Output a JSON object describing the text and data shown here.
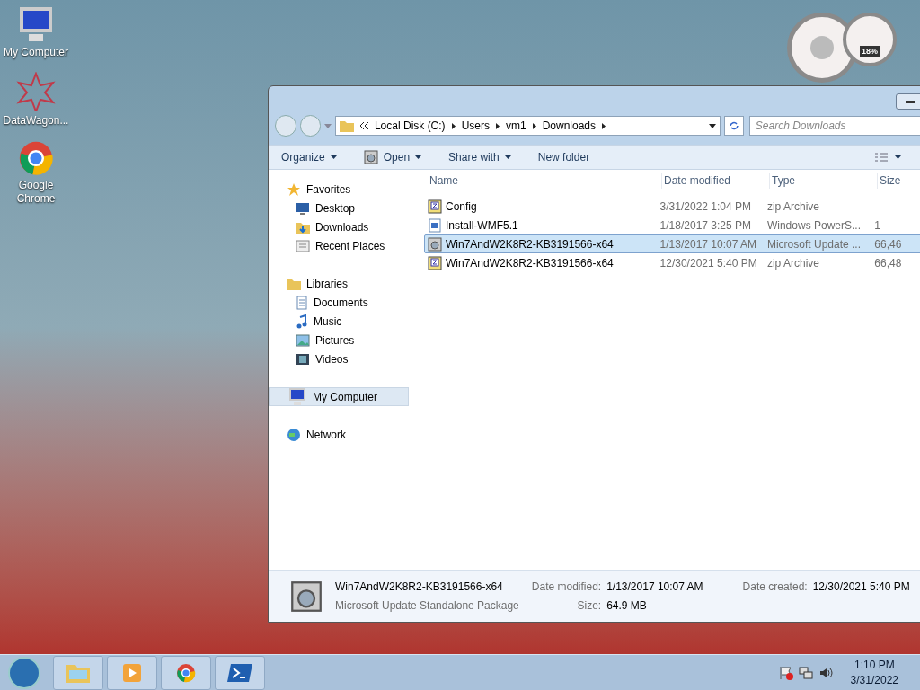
{
  "desktop_icons": [
    {
      "label": "My Computer",
      "kind": "computer"
    },
    {
      "label": "DataWagon...",
      "kind": "star"
    },
    {
      "label": "Google Chrome",
      "kind": "chrome"
    }
  ],
  "gadget": {
    "reading": "18%"
  },
  "explorer": {
    "breadcrumb": [
      "Local Disk (C:)",
      "Users",
      "vm1",
      "Downloads"
    ],
    "search": {
      "placeholder": "Search Downloads"
    },
    "toolbar": [
      {
        "label": "Open",
        "kind": "icon-menu"
      },
      {
        "label": "Share with",
        "kind": "menu"
      },
      {
        "label": "New folder",
        "kind": "plain"
      }
    ],
    "organize": "Organize",
    "nav": [
      {
        "label": "Favorites",
        "kind": "star",
        "selected": false,
        "children": [
          {
            "label": "Desktop",
            "kind": "desktop",
            "selected": false
          },
          {
            "label": "Downloads",
            "kind": "folder",
            "selected": false
          },
          {
            "label": "Recent Places",
            "kind": "recent",
            "selected": false
          }
        ]
      },
      {
        "label": "Libraries",
        "kind": "library",
        "selected": false,
        "children": [
          {
            "label": "Documents",
            "kind": "doc",
            "selected": false
          },
          {
            "label": "Music",
            "kind": "music",
            "selected": false
          },
          {
            "label": "Pictures",
            "kind": "picture",
            "selected": false
          },
          {
            "label": "Videos",
            "kind": "video",
            "selected": false
          }
        ]
      },
      {
        "label": "My Computer",
        "kind": "computer",
        "selected": true
      },
      {
        "label": "Network",
        "kind": "network",
        "selected": false
      }
    ],
    "columns": [
      "Name",
      "Date modified",
      "Type",
      "Size"
    ],
    "rows": [
      {
        "name": "Config",
        "date": "3/31/2022 1:04 PM",
        "type": "zip Archive",
        "kind": "zip",
        "selected": false
      },
      {
        "name": "Install-WMF5.1",
        "date": "1/18/2017 3:25 PM",
        "type": "Windows PowerS...",
        "size": "1",
        "kind": "script",
        "selected": false
      },
      {
        "name": "Win7AndW2K8R2-KB3191566-x64",
        "date": "1/13/2017 10:07 AM",
        "type": "Microsoft Update ...",
        "size": "66,46",
        "kind": "package",
        "selected": true
      },
      {
        "name": "Win7AndW2K8R2-KB3191566-x64",
        "date": "12/30/2021 5:40 PM",
        "type": "zip Archive",
        "size": "66,48",
        "kind": "zip",
        "selected": false
      }
    ],
    "details": {
      "name": "Win7AndW2K8R2-KB3191566-x64",
      "type": "Microsoft Update Standalone Package",
      "modified_label": "Date modified:",
      "modified": "1/13/2017 10:07 AM",
      "size_label": "Size:",
      "size": "64.9 MB",
      "created_label": "Date created:",
      "created": "12/30/2021 5:40 PM"
    }
  },
  "taskbar": {
    "apps": [
      {
        "kind": "explorer"
      },
      {
        "kind": "media"
      },
      {
        "kind": "chrome"
      },
      {
        "kind": "powershell"
      }
    ],
    "time": "1:10 PM",
    "date": "3/31/2022"
  }
}
